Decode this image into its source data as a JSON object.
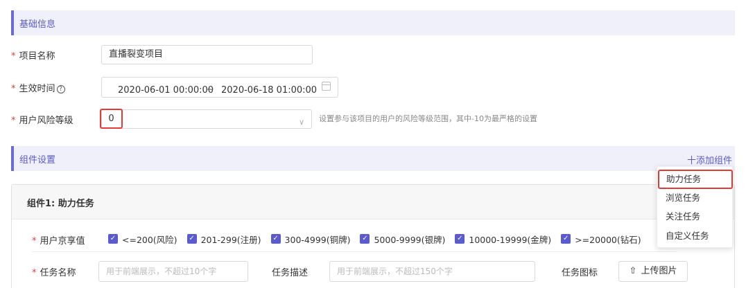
{
  "sections": {
    "basic": "基础信息",
    "component": "组件设置"
  },
  "form": {
    "project_name_label": "项目名称",
    "project_name_value": "直播裂变项目",
    "effective_time_label": "生效时间",
    "help_icon": "?",
    "date_start": "2020-06-01 00:00:00",
    "date_sep": "~",
    "date_end": "2020-06-18 01:00:00",
    "risk_label": "用户风险等级",
    "risk_value": "0",
    "risk_hint": "设置参与该项目的用户的风险等级范围，其中-10为最严格的设置"
  },
  "add_component": "十添加组件",
  "card": {
    "title": "组件1: 助力任务",
    "jingxiang_label": "用户京享值",
    "checkboxes": [
      "<=200(风险)",
      "201-299(注册)",
      "300-4999(铜牌)",
      "5000-9999(银牌)",
      "10000-19999(金牌)",
      ">=20000(钻石)"
    ],
    "task_name_label": "任务名称",
    "task_name_placeholder": "用于前端展示，不超过10个字",
    "task_desc_label": "任务描述",
    "task_desc_placeholder": "用于前端展示，不超过150个字",
    "task_icon_label": "任务图标",
    "upload_label": "上传图片"
  },
  "dropdown": [
    "助力任务",
    "浏览任务",
    "关注任务",
    "自定义任务"
  ],
  "required_mark": "*",
  "check_glyph": "✓",
  "upload_glyph": "⇧",
  "chevron_glyph": "∨"
}
